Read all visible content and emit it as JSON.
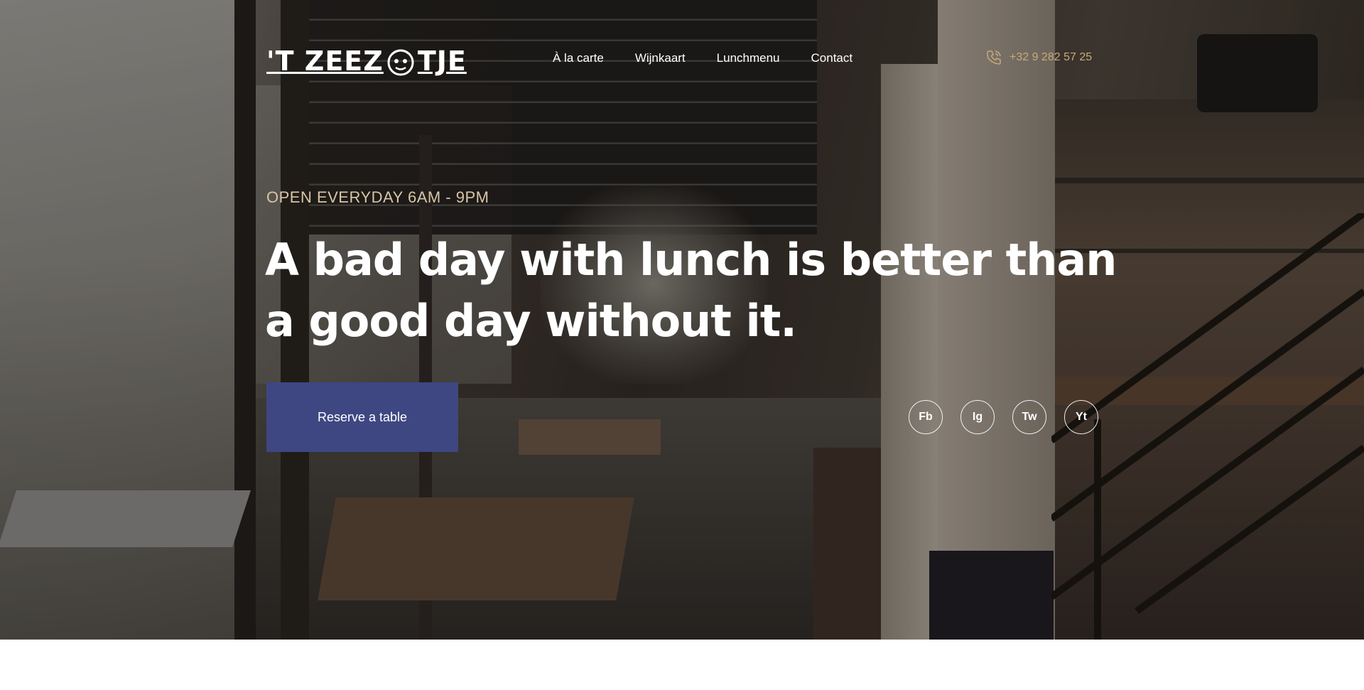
{
  "brand": {
    "logo_text_left": "'T ZEEZ",
    "logo_text_right": "TJE",
    "logo_icon": "mascot-icon"
  },
  "nav": {
    "items": [
      {
        "label": "À la carte"
      },
      {
        "label": "Wijnkaart"
      },
      {
        "label": "Lunchmenu"
      },
      {
        "label": "Contact"
      }
    ]
  },
  "contact": {
    "phone": "+32 9 282 57 25",
    "phone_icon": "phone-icon"
  },
  "hero": {
    "eyebrow": "OPEN EVERYDAY 6AM - 9PM",
    "headline_line1": "A bad day with lunch is better than",
    "headline_line2": "a good day without it.",
    "cta_label": "Reserve a table"
  },
  "socials": {
    "items": [
      {
        "label": "Fb"
      },
      {
        "label": "Ig"
      },
      {
        "label": "Tw"
      },
      {
        "label": "Yt"
      }
    ]
  },
  "colors": {
    "accent_button": "#3e4782",
    "phone_gold": "#c9a97a",
    "eyebrow": "#d8c5a6"
  }
}
